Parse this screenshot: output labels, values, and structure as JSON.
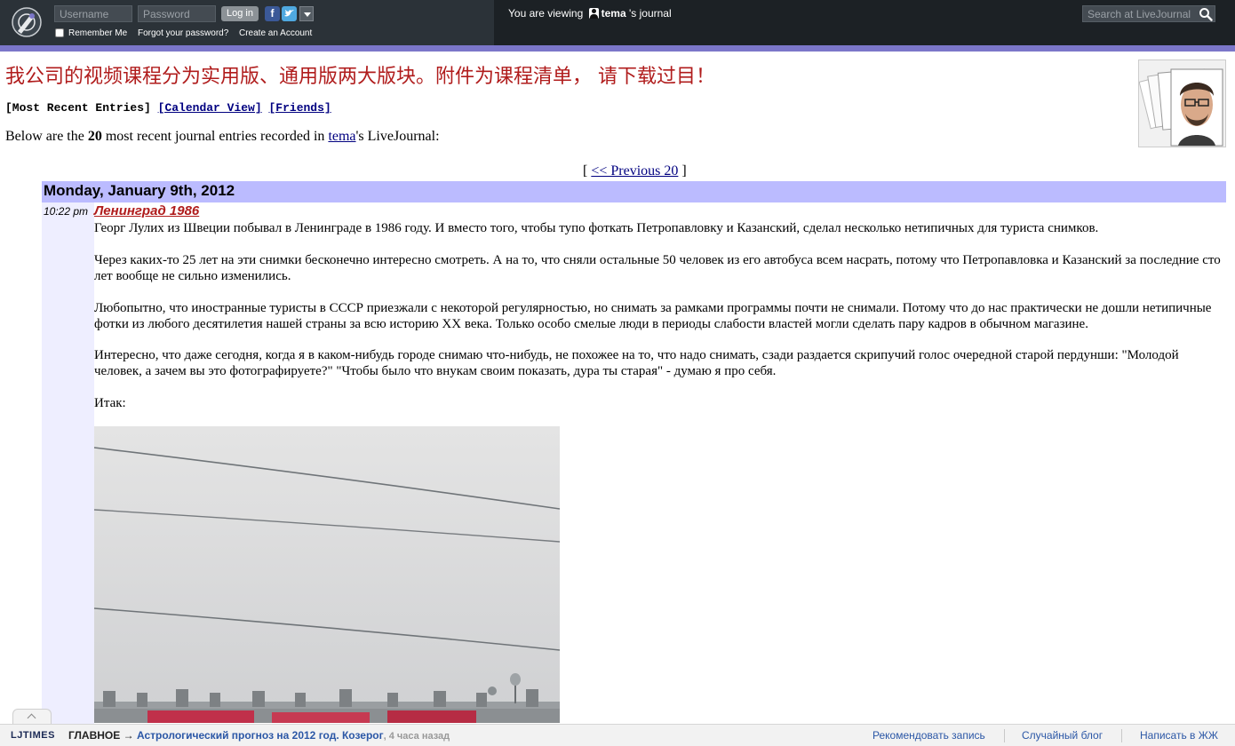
{
  "topbar": {
    "username_placeholder": "Username",
    "password_placeholder": "Password",
    "login_label": "Log in",
    "remember_label": "Remember Me",
    "forgot_label": "Forgot your password?",
    "create_label": "Create an Account",
    "viewing_prefix": "You are viewing",
    "viewing_user": "tema",
    "viewing_suffix": "'s journal",
    "search_placeholder": "Search at LiveJournal",
    "icons": [
      "livejournal-logo-icon",
      "facebook-icon",
      "twitter-icon",
      "chevron-down-icon",
      "user-icon",
      "search-icon"
    ]
  },
  "header": {
    "title": "我公司的视频课程分为实用版、通用版两大版块。附件为课程清单， 请下载过目！",
    "nav": {
      "recent": "[Most Recent Entries]",
      "calendar": "[Calendar View]",
      "friends": "[Friends]"
    },
    "intro": {
      "before": "Below are the ",
      "count": "20",
      "middle": " most recent journal entries recorded in ",
      "user": "tema",
      "after": "'s LiveJournal:"
    },
    "prev_nav": {
      "open": "[ ",
      "link": "<< Previous 20",
      "close": " ]"
    }
  },
  "entry": {
    "date": "Monday, January 9th, 2012",
    "time": "10:22 pm",
    "subject": "Ленинград 1986",
    "paragraphs": [
      "Георг Лулих из Швеции побывал в Ленинграде в 1986 году. И вместо того, чтобы тупо фоткать Петропавловку и Казанский, сделал несколько нетипичных для туриста снимков.",
      "Через каких-то 25 лет на эти снимки бесконечно интересно смотреть. А на то, что сняли остальные 50 человек из его автобуса всем насрать, потому что Петропавловка и Казанский за последние сто лет вообще не сильно изменились.",
      "Любопытно, что иностранные туристы в СССР приезжали с некоторой регулярностью, но снимать за рамками программы почти не снимали. Потому что до нас практически не дошли нетипичные фотки из любого десятилетия нашей страны за всю историю XX века. Только особо смелые люди в периоды слабости властей могли сделать пару кадров в обычном магазине.",
      "Интересно, что даже сегодня, когда я в каком-нибудь городе снимаю что-нибудь, не похожее на то, что надо снимать, сзади раздается скрипучий голос очередной старой пердунши: \"Молодой человек, а зачем вы это фотографируете?\" \"Чтобы было что внукам своим показать, дура ты старая\" - думаю я про себя.",
      "Итак:"
    ]
  },
  "bottombar": {
    "brand": "LJTIMES",
    "main_label": "ГЛАВНОЕ →",
    "headline": "Астрологический прогноз на 2012 год. Козерог",
    "time_ago": ", 4 часа назад",
    "recommend": "Рекомендовать запись",
    "random": "Случайный блог",
    "write": "Написать в ЖЖ"
  },
  "colors": {
    "topbar": "#2b3238",
    "accent_stripe": "#7b76c9",
    "date_bar": "#bbbbff",
    "side_column": "#eeeeff",
    "title_red": "#b01c1c",
    "link_blue": "#000080"
  }
}
